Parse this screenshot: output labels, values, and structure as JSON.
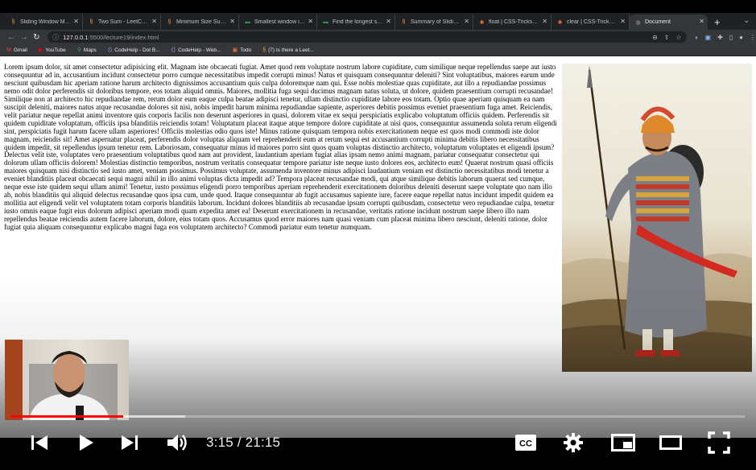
{
  "browser": {
    "tabs": [
      {
        "title": "Sliding Window Maxim",
        "favicon": "codehelp-icon",
        "active": false
      },
      {
        "title": "Two Sum - LeetCode",
        "favicon": "leetcode-icon",
        "active": false
      },
      {
        "title": "Minimum Size Subarray",
        "favicon": "leetcode-icon",
        "active": false
      },
      {
        "title": "Smallest window in a S",
        "favicon": "gfg-icon",
        "active": false
      },
      {
        "title": "Find the longest subst",
        "favicon": "gfg-icon",
        "active": false
      },
      {
        "title": "Summary of Sliding Wi",
        "favicon": "leetcode-icon",
        "active": false
      },
      {
        "title": "float | CSS-Tricks - CSS",
        "favicon": "csstricks-icon",
        "active": false
      },
      {
        "title": "clear | CSS-Tricks - CSS",
        "favicon": "csstricks-icon",
        "active": false
      },
      {
        "title": "Document",
        "favicon": "globe-icon",
        "active": true
      }
    ],
    "url_host": "127.0.0.1",
    "url_rest": ":5500/lecture19/index.html",
    "bookmarks": [
      {
        "label": "Gmail",
        "icon": "gmail-icon"
      },
      {
        "label": "YouTube",
        "icon": "youtube-icon"
      },
      {
        "label": "Maps",
        "icon": "maps-icon"
      },
      {
        "label": "CodeHelp - Dot B...",
        "icon": "codehelp-icon"
      },
      {
        "label": "CodeHelp - Web...",
        "icon": "codehelp-icon"
      },
      {
        "label": "Todo",
        "icon": "todo-icon"
      },
      {
        "label": "(7) Is there a Leet...",
        "icon": "leetcode-icon"
      }
    ]
  },
  "page": {
    "paragraph": "Lorem ipsum dolor, sit amet consectetur adipisicing elit. Magnam iste obcaecati fugiat. Amet quod rem voluptate nostrum labore cupiditate, cum similique neque repellendus saepe aut iusto consequuntur ad in, accusantium incidunt consectetur porro cumque necessitatibus impedit corrupti minus! Natus et quisquam consequuntur deleniti? Sint voluptatibus, maiores earum unde nesciunt quibusdam hic aperiam ratione harum architecto dignissimos accusantium quis culpa doloremque nam qui. Esse nobis molestiae quas cupiditate, aut illo a repudiandae possimus nemo odit dolor perferendis sit doloribus tempore, eos totam aliquid omnis. Maiores, mollitia fuga sequi ducimus magnam natus soluta, ut dolore, quidem praesentium corrupti recusandae! Similique non at architecto hic repudiandae rem, rerum dolor eum eaque culpa beatae adipisci tenetur, ullam distinctio cupiditate labore eos totam. Optio quae aperiam quisquam ea nam suscipit deleniti, maiores natus atque recusandae dolores sit nisi, nobis impedit harum minima repudiandae sapiente, asperiores debitis possimus eveniet praesentium fuga amet. Reiciendis, velit pariatur neque repellat animi inventore quis corporis facilis non deserunt asperiores in quasi, dolorem vitae ex sequi perspiciatis explicabo voluptatum officiis quidem. Perferendis sit quidem cupiditate voluptatum, officiis ipsa blanditiis reiciendis totam! Voluptatum placeat itaque atque tempore dolore cupiditate at nisi quos, consequuntur assumenda soluta rerum eligendi sint, perspiciatis fugit harum facere ullam asperiores! Officiis molestias odio quos iste! Minus ratione quisquam tempora nobis exercitationem neque est quos modi commodi iste dolor magnam, reiciendis sit! Amet aspernatur placeat, perferendis dolor voluptas aliquam vel reprehenderit eum at rerum sequi est accusantium corrupti minima debitis libero necessitatibus quidem impedit, sit repellendus ipsum tenetur rem. Laboriosam, consequatur minus id maiores porro sint quos quam voluptas distinctio architecto, voluptatum voluptates et eligendi ipsum? Delectus velit iste, voluptates vero praesentium voluptatibus quod nam aut provident, laudantium aperiam fugiat alias ipsam nemo animi magnam, pariatur consequatur consectetur qui dolorum ullam officiis dolorem! Molestias distinctio temporibus, nostrum veritatis consequatur tempore pariatur iste neque iusto dolores eos, architecto eum! Quaerat nostrum quasi officiis maiores quisquam nisi distinctio sed iusto amet, veniam possimus. Possimus voluptate, assumenda inventore minus adipisci laudantium veniam est distinctio necessitatibus modi tenetur a eveniet blanditiis placeat obcaecati sequi magni nihil in illo animi voluptas dicta impedit ad? Tempora placeat recusandae modi, qui atque similique debitis laborum quaerat sed cumque, neque esse iste quidem sequi ullam animi! Tenetur, iusto possimus eligendi porro temporibus aperiam reprehenderit exercitationem doloribus deleniti deserunt saepe voluptate quo nam illo ab, nobis blanditiis qui aliquid delectus recusandae quos ipsa cum, unde quod. Itaque consequuntur ab fugit accusamus sapiente iure, facere eaque repellat natus incidunt impedit quidem ea mollitia aut eligendi velit vel voluptatem totam corporis blanditiis laborum. Incidunt dolores blanditiis ab recusandae ipsum corrupti quibusdam, consectetur vero repudiandae culpa, tenetur iusto omnis eaque fugit eius dolorum adipisci aperiam modi quam expedita amet ea! Deserunt exercitationem in recusandae, veritatis ratione incidunt nostrum saepe libero illo nam repellendus beatae reiciendis autem facere laborum, dolore, eius totam quos. Accusamus quod error maiores nam quasi veniam cum placeat minima libero nesciunt, deleniti ratione, dolor fugiat quia aliquam consequuntur explicabo magni fuga eos voluptatem architecto? Commodi pariatur eum tenetur numquam."
  },
  "player": {
    "current_time": "3:15",
    "duration": "21:15",
    "time_display": "3:15 / 21:15",
    "progress_played": 0.153,
    "progress_buffered": 0.237,
    "accent": "#ff0000"
  },
  "colors": {
    "chrome_dark": "#202124",
    "chrome_toolbar": "#35363a"
  }
}
